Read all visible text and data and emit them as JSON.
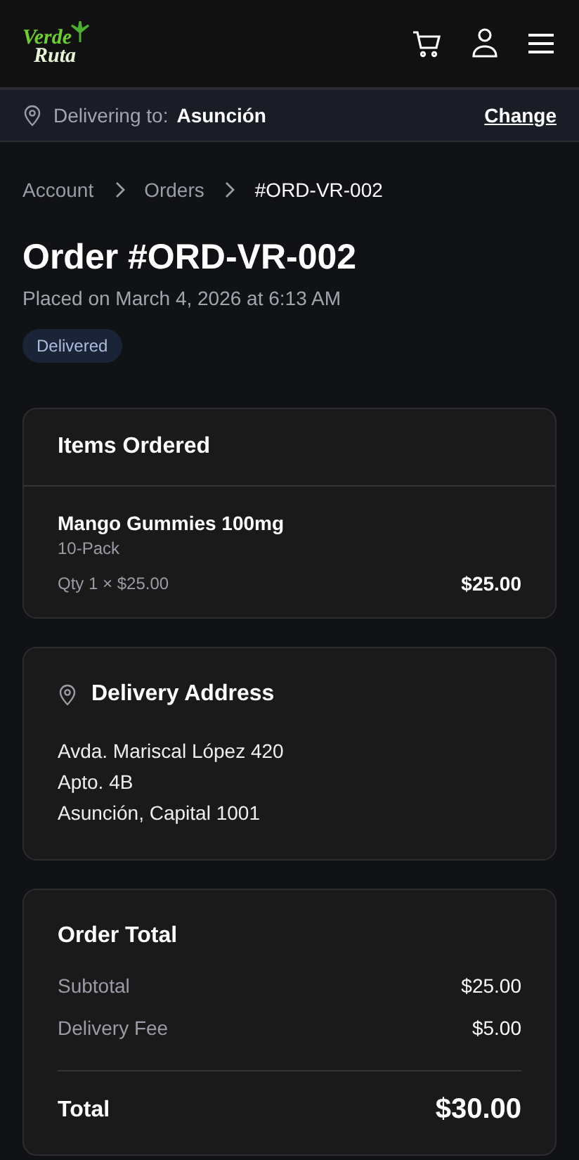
{
  "header": {
    "logo": [
      "Verde",
      "Ruta"
    ]
  },
  "delivery_bar": {
    "label": "Delivering to:",
    "city": "Asunción",
    "action": "Change"
  },
  "breadcrumb": [
    {
      "label": "Account",
      "current": false
    },
    {
      "label": "Orders",
      "current": false
    },
    {
      "label": "#ORD-VR-002",
      "current": true
    }
  ],
  "order": {
    "title": "Order #ORD-VR-002",
    "placed": "Placed on March 4, 2026 at 6:13 AM",
    "status": "Delivered"
  },
  "items_card": {
    "title": "Items Ordered",
    "items": [
      {
        "name": "Mango Gummies 100mg",
        "variant": "10-Pack",
        "qty": "Qty 1 × $25.00",
        "price": "$25.00"
      }
    ]
  },
  "address_card": {
    "title": "Delivery Address",
    "lines": [
      "Avda. Mariscal López 420",
      "Apto. 4B",
      "Asunción, Capital 1001"
    ]
  },
  "total_card": {
    "title": "Order Total",
    "rows": [
      {
        "label": "Subtotal",
        "value": "$25.00"
      },
      {
        "label": "Delivery Fee",
        "value": "$5.00"
      }
    ],
    "total": {
      "label": "Total",
      "value": "$30.00"
    }
  }
}
